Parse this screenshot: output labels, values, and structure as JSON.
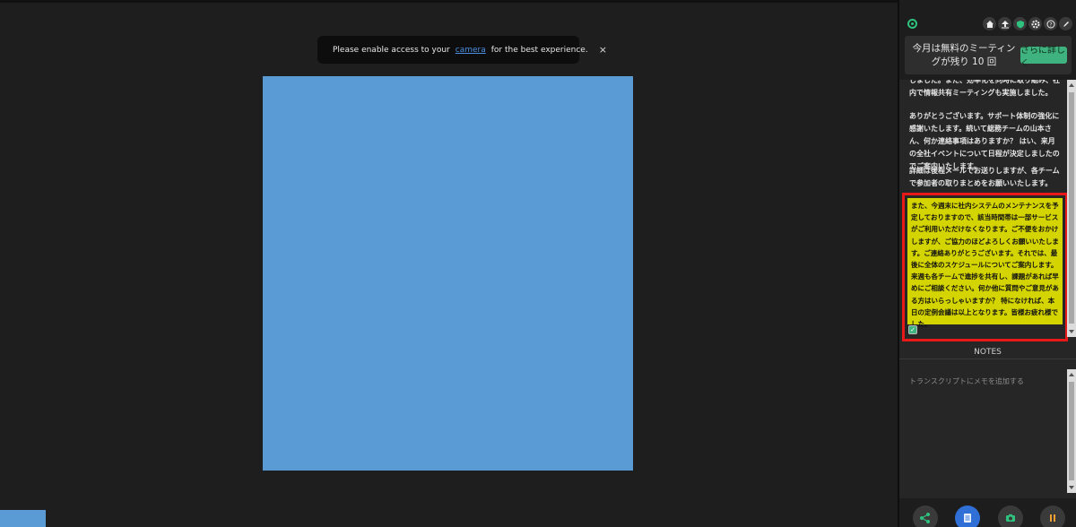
{
  "toast": {
    "text_before": "Please enable access to your",
    "link": "camera",
    "text_after": "for the best experience.",
    "close": "×"
  },
  "panel": {
    "toolbar_icons": [
      "home-icon",
      "upload-icon",
      "shield-icon",
      "gear-icon",
      "help-icon",
      "pen-icon"
    ],
    "upgrade": {
      "message": "今月は無料のミーティングが残り 10 回",
      "button": "さらに詳しく"
    },
    "transcript": [
      "しました。また、効率化を同時に取り組み、社内で情報共有ミーティングも実施しました。",
      "ありがとうございます。サポート体制の強化に感謝いたします。続いて総務チームの山本さん、何か連絡事項はありますか？ はい、来月の全社イベントについて日程が決定しましたのでご案内いたします。",
      "詳細は後程メールでお送りしますが、各チームで参加者の取りまとめをお願いいたします。"
    ],
    "highlighted": "また、今週末に社内システムのメンテナンスを予定しておりますので、該当時間帯は一部サービスがご利用いただけなくなります。ご不便をおかけしますが、ご協力のほどよろしくお願いいたします。ご連絡ありがとうございます。それでは、最後に全体のスケジュールについてご案内します。来週も各チームで進捗を共有し、課題があれば早めにご相談ください。何か他に質問やご意見がある方はいらっしゃいますか？ 特になければ、本日の定例会議は以上となります。皆様お疲れ様でした。",
    "checkbox_mark": "✓",
    "notes_label": "NOTES",
    "notes_placeholder": "トランスクリプトにメモを追加する",
    "bottom_icons": [
      "share-icon",
      "document-icon",
      "camera-icon",
      "pause-icon"
    ]
  },
  "colors": {
    "video_tile": "#5b9bd5",
    "highlight": "#d4d400",
    "highlight_border": "#e81919",
    "accent_green": "#3fb37f",
    "link_blue": "#4a8fe0",
    "pause_orange": "#f0a030"
  }
}
